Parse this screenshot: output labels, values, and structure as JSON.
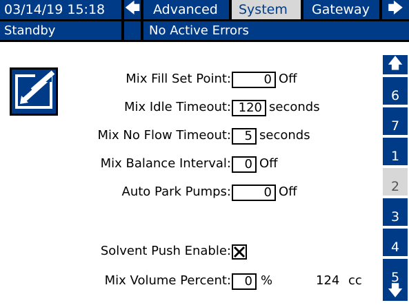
{
  "header": {
    "datetime": "03/14/19 15:18",
    "left_arrow": "🡄",
    "tabs": [
      {
        "label": "Advanced",
        "active": false
      },
      {
        "label": "System",
        "active": true
      },
      {
        "label": "Gateway",
        "active": false
      }
    ],
    "right_arrow": "🡆"
  },
  "status": {
    "mode": "Standby",
    "errors": "No Active Errors"
  },
  "side_nav": {
    "up": "🡅",
    "pages": [
      "6",
      "7",
      "1",
      "2",
      "3",
      "4",
      "5"
    ],
    "active_page": "2",
    "down": "🡇"
  },
  "edit_icon": "edit-icon",
  "form": {
    "fill_set_point": {
      "label": "Mix Fill Set Point:",
      "value": "0",
      "unit": "Off"
    },
    "idle_timeout": {
      "label": "Mix Idle Timeout:",
      "value": "120",
      "unit": "seconds"
    },
    "no_flow_timeout": {
      "label": "Mix No Flow Timeout:",
      "value": "5",
      "unit": "seconds"
    },
    "balance_interval": {
      "label": "Mix Balance Interval:",
      "value": "0",
      "unit": "Off"
    },
    "auto_park": {
      "label": "Auto Park Pumps:",
      "value": "0",
      "unit": "Off"
    },
    "solvent_push": {
      "label": "Solvent Push Enable:",
      "checked": true,
      "mark": "✕"
    },
    "volume_percent": {
      "label": "Mix Volume Percent:",
      "value": "0",
      "unit": "%",
      "volume": "124",
      "volume_unit": "cc"
    }
  },
  "colors": {
    "bar": "#003b87",
    "active_tab": "#d7d7d7"
  }
}
